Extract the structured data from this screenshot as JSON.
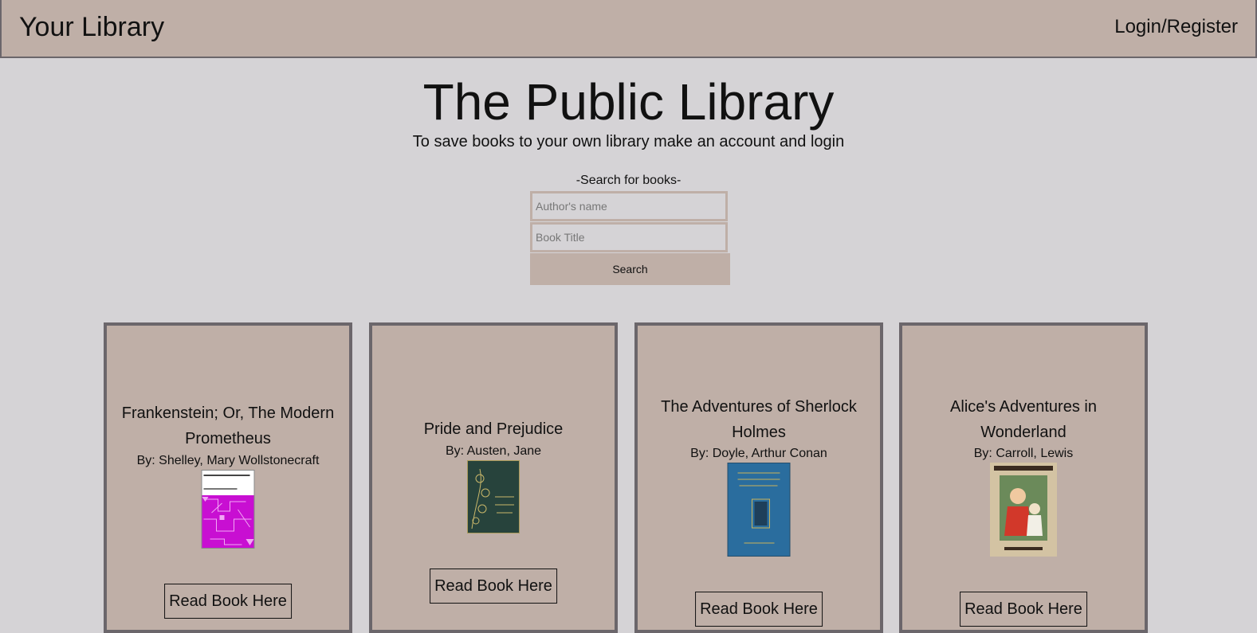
{
  "header": {
    "brand": "Your Library",
    "login_label": "Login/Register"
  },
  "hero": {
    "title": "The Public Library",
    "subtitle": "To save books to your own library make an account and login"
  },
  "search": {
    "label": "-Search for books-",
    "author_placeholder": "Author's name",
    "title_placeholder": "Book Title",
    "button_label": "Search"
  },
  "books": [
    {
      "title": "Frankenstein; Or, The Modern Prometheus",
      "author": "By: Shelley, Mary Wollstonecraft",
      "cover_icon": "frankenstein-cover-image",
      "cover_color": "#c80fd2",
      "button_label": "Read Book Here"
    },
    {
      "title": "Pride and Prejudice",
      "author": "By: Austen, Jane",
      "cover_icon": "pride-and-prejudice-cover-image",
      "cover_color": "#27433c",
      "button_label": "Read Book Here"
    },
    {
      "title": "The Adventures of Sherlock Holmes",
      "author": "By: Doyle, Arthur Conan",
      "cover_icon": "sherlock-holmes-cover-image",
      "cover_color": "#2a6d9e",
      "button_label": "Read Book Here"
    },
    {
      "title": "Alice's Adventures in Wonderland",
      "author": "By: Carroll, Lewis",
      "cover_icon": "alice-in-wonderland-cover-image",
      "cover_color": "#d3c3a3",
      "button_label": "Read Book Here"
    }
  ],
  "theme": {
    "header_bg": "#bfafa7",
    "page_bg": "#d5d3d6",
    "card_border": "#6b666b"
  }
}
